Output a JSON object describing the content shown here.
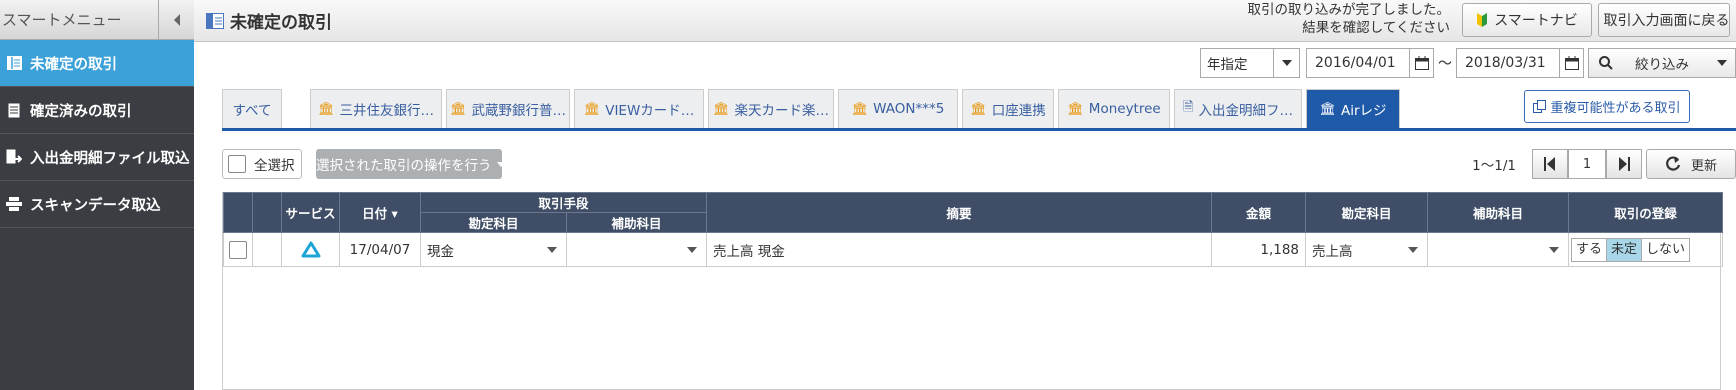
{
  "sidebar": {
    "title": "スマートメニュー",
    "items": [
      {
        "label": "未確定の取引",
        "icon": "ledger-icon",
        "active": true
      },
      {
        "label": "確定済みの取引",
        "icon": "document-icon",
        "active": false
      },
      {
        "label": "入出金明細ファイル取込",
        "icon": "file-import-icon",
        "active": false
      },
      {
        "label": "スキャンデータ取込",
        "icon": "scanner-icon",
        "active": false
      }
    ]
  },
  "header": {
    "title": "未確定の取引",
    "message_line1": "取引の取り込みが完了しました。",
    "message_line2": "結果を確認してください",
    "smart_navi_label": "スマートナビ",
    "back_label": "取引入力画面に戻る"
  },
  "filters": {
    "period_type": "年指定",
    "date_from": "2016/04/01",
    "range_sep": "～",
    "date_to": "2018/03/31",
    "narrow_label": "絞り込み"
  },
  "tabs": [
    {
      "label": "すべて",
      "icon": ""
    },
    {
      "label": "三井住友銀行…",
      "icon": "bank-icon"
    },
    {
      "label": "武蔵野銀行普…",
      "icon": "bank-icon"
    },
    {
      "label": "VIEWカード…",
      "icon": "bank-icon"
    },
    {
      "label": "楽天カード楽…",
      "icon": "bank-icon"
    },
    {
      "label": "WAON***5",
      "icon": "bank-icon"
    },
    {
      "label": "口座連携",
      "icon": "bank-icon"
    },
    {
      "label": "Moneytree",
      "icon": "bank-icon"
    },
    {
      "label": "入出金明細フ…",
      "icon": "file-icon"
    },
    {
      "label": "Airレジ",
      "icon": "bank-icon"
    }
  ],
  "duplicate_button": "重複可能性がある取引",
  "toolbar": {
    "select_all": "全選択",
    "operation": "選択された取引の操作を行う",
    "range": "1～1/1",
    "page": "1",
    "refresh": "更新"
  },
  "table": {
    "headers": {
      "service": "サービス",
      "date": "日付",
      "method": "取引手段",
      "method_account": "勘定科目",
      "method_sub": "補助科目",
      "summary": "摘要",
      "amount": "金額",
      "account": "勘定科目",
      "sub": "補助科目",
      "register": "取引の登録"
    },
    "rows": [
      {
        "date": "17/04/07",
        "method_account": "現金",
        "method_sub": "",
        "summary": "売上高 現金",
        "amount": "1,188",
        "account": "売上高",
        "sub": "",
        "register_yes": "する",
        "register_pending": "未定",
        "register_no": "しない"
      }
    ]
  },
  "colors": {
    "sidebar_bg": "#3a3d42",
    "active_blue": "#3ba1d8",
    "tab_active": "#1f5aa8",
    "table_header": "#3f4e66",
    "airregi": "#1ea5d6"
  }
}
